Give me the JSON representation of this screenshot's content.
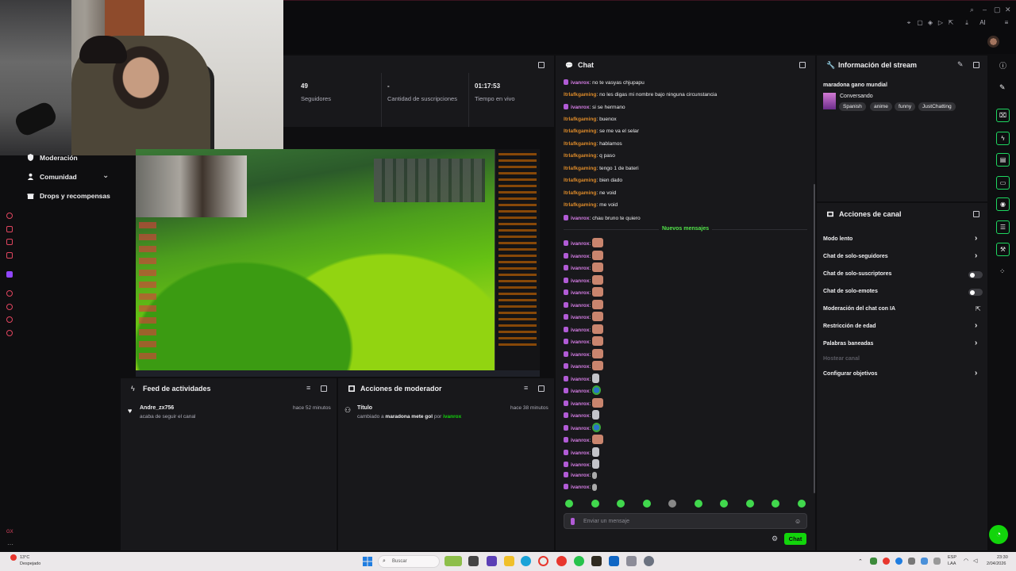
{
  "topbar": {
    "right_icons": [
      "search-icon",
      "minimize-icon",
      "maximize-icon",
      "close-icon"
    ],
    "tool_icons": [
      "pin-icon",
      "crop-icon",
      "shield-icon",
      "play-icon",
      "export-icon",
      "download-icon",
      "ai-icon",
      "menu-icon"
    ],
    "ai_label": "AI"
  },
  "sidebar": {
    "items": [
      {
        "label": "Moderación",
        "icon": "shield-icon"
      },
      {
        "label": "Comunidad",
        "icon": "community-icon"
      },
      {
        "label": "Drops y recompensas",
        "icon": "gift-icon"
      }
    ]
  },
  "stats": {
    "followers_value": "49",
    "followers_label": "Seguidores",
    "subs_value": "-",
    "subs_label": "Cantidad de suscripciones",
    "live_value": "01:17:53",
    "live_label": "Tiempo en vivo"
  },
  "feed": {
    "title": "Feed de actividades",
    "items": [
      {
        "user": "Andre_zx756",
        "text": "acaba de seguir el canal",
        "time": "hace 52 minutos"
      }
    ]
  },
  "modactions": {
    "title": "Acciones de moderador",
    "items": [
      {
        "action": "Título",
        "prefix": "cambiado a",
        "value": "maradona mete gol",
        "by": "por",
        "mod": "ivanrox",
        "time": "hace 38 minutos"
      }
    ]
  },
  "chat": {
    "title": "Chat",
    "messages": [
      {
        "user": "ivanrox",
        "text": ": no te vasyas chjupapu",
        "color": "pink",
        "badge": true
      },
      {
        "user": "ltrlafkgaming",
        "text": ": no les digas mi nombre bajo ninguna circunstancia",
        "color": "orange",
        "badge": false
      },
      {
        "user": "ivanrox",
        "text": ": si se hermano",
        "color": "pink",
        "badge": true
      },
      {
        "user": "ltrlafkgaming",
        "text": ": buenox",
        "color": "orange",
        "badge": false
      },
      {
        "user": "ltrlafkgaming",
        "text": ": se me va el selar",
        "color": "orange",
        "badge": false
      },
      {
        "user": "ltrlafkgaming",
        "text": ": hablamos",
        "color": "orange",
        "badge": false
      },
      {
        "user": "ltrlafkgaming",
        "text": ": q paso",
        "color": "orange",
        "badge": false
      },
      {
        "user": "ltrlafkgaming",
        "text": ": tengo 1 de bateri",
        "color": "orange",
        "badge": false
      },
      {
        "user": "ltrlafkgaming",
        "text": ": bien dado",
        "color": "orange",
        "badge": false
      },
      {
        "user": "ltrlafkgaming",
        "text": ": ne void",
        "color": "orange",
        "badge": false
      },
      {
        "user": "ltrlafkgaming",
        "text": ": me void",
        "color": "orange",
        "badge": false
      },
      {
        "user": "ivanrox",
        "text": ": chau bruno te quiero",
        "color": "pink",
        "badge": true
      }
    ],
    "new_messages_label": "Nuevos mensajes",
    "emote_messages": [
      {
        "user": "ivanrox",
        "emote": "hand"
      },
      {
        "user": "ivanrox",
        "emote": "hand"
      },
      {
        "user": "ivanrox",
        "emote": "hand"
      },
      {
        "user": "ivanrox",
        "emote": "hand"
      },
      {
        "user": "ivanrox",
        "emote": "hand"
      },
      {
        "user": "ivanrox",
        "emote": "hand"
      },
      {
        "user": "ivanrox",
        "emote": "hand"
      },
      {
        "user": "ivanrox",
        "emote": "hand"
      },
      {
        "user": "ivanrox",
        "emote": "hand"
      },
      {
        "user": "ivanrox",
        "emote": "hand"
      },
      {
        "user": "ivanrox",
        "emote": "hand"
      },
      {
        "user": "ivanrox",
        "emote": "sticker"
      },
      {
        "user": "ivanrox",
        "emote": "earth"
      },
      {
        "user": "ivanrox",
        "emote": "hand"
      },
      {
        "user": "ivanrox",
        "emote": "sticker"
      },
      {
        "user": "ivanrox",
        "emote": "earth"
      },
      {
        "user": "ivanrox",
        "emote": "hand"
      },
      {
        "user": "ivanrox",
        "emote": "sticker"
      },
      {
        "user": "ivanrox",
        "emote": "sticker"
      },
      {
        "user": "ivanrox",
        "emote": "tiny"
      },
      {
        "user": "ivanrox",
        "emote": "tiny"
      }
    ],
    "input_placeholder": "Enviar un mensaje",
    "send_label": "Chat"
  },
  "stream_info": {
    "title_header": "Información del stream",
    "stream_title": "maradona gano mundial",
    "category": "Conversando",
    "tags": [
      "Spanish",
      "anime",
      "funny",
      "JustChatting"
    ]
  },
  "channel_actions": {
    "title": "Acciones de canal",
    "rows": [
      {
        "label": "Modo lento",
        "control": "chevron"
      },
      {
        "label": "Chat de solo-seguidores",
        "control": "chevron"
      },
      {
        "label": "Chat de solo-suscriptores",
        "control": "toggle"
      },
      {
        "label": "Chat de solo-emotes",
        "control": "toggle"
      },
      {
        "label": "Moderación del chat con IA",
        "control": "external"
      },
      {
        "label": "Restricción de edad",
        "control": "chevron"
      },
      {
        "label": "Palabras baneadas",
        "control": "chevron"
      },
      {
        "label": "Hostear canal",
        "control": "none",
        "disabled": true
      },
      {
        "label": "Configurar objetivos",
        "control": "chevron"
      }
    ]
  },
  "taskbar": {
    "weather_temp": "13°C",
    "weather_desc": "Despejado",
    "search_label": "Buscar",
    "lang_top": "ESP",
    "lang_bottom": "LAA",
    "time": "23:30",
    "date": "2/04/2026"
  },
  "colors": {
    "accent_green": "#12d50b",
    "chat_pink": "#d67ee6",
    "chat_orange": "#dc8a2a",
    "panel_bg": "#18181b",
    "app_bg": "#0e0e10"
  }
}
